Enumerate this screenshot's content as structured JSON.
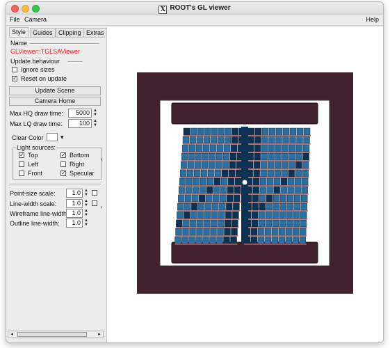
{
  "window": {
    "title": "ROOT's GL viewer",
    "title_icon": "X"
  },
  "menubar": {
    "file": "File",
    "camera": "Camera",
    "help": "Help"
  },
  "tabs": [
    "Style",
    "Guides",
    "Clipping",
    "Extras"
  ],
  "style_tab": {
    "name_label": "Name",
    "name_value": "GLViewer::TGLSAViewer",
    "update_behaviour": "Update behaviour",
    "ignore_sizes": {
      "label": "Ignore sizes",
      "checked": false
    },
    "reset_on_update": {
      "label": "Reset on update",
      "checked": true
    },
    "update_scene_button": "Update Scene",
    "camera_home_button": "Camera Home",
    "max_hq_label": "Max HQ draw time:",
    "max_hq_value": "5000",
    "max_lq_label": "Max LQ draw time:",
    "max_lq_value": "100",
    "clear_color_label": "Clear Color",
    "clear_color_arrow": "▾",
    "light_sources": {
      "title": "Light sources:",
      "top": {
        "label": "Top",
        "checked": true
      },
      "bottom": {
        "label": "Bottom",
        "checked": true
      },
      "left": {
        "label": "Left",
        "checked": false
      },
      "right": {
        "label": "Right",
        "checked": false
      },
      "front": {
        "label": "Front",
        "checked": false
      },
      "specular": {
        "label": "Specular",
        "checked": true
      }
    },
    "point_size_label": "Point-size scale:",
    "point_size_value": "1.0",
    "line_width_label": "Line-width scale:",
    "line_width_value": "1.0",
    "wireframe_label": "Wireframe line-width:",
    "wireframe_value": "1.0",
    "outline_label": "Outline line-width:",
    "outline_value": "1.0"
  },
  "check_glyph": "✓",
  "scroll": {
    "left_arrow": "◂",
    "right_arrow": "▸"
  },
  "side_arrow": "›",
  "spin": {
    "up": "▲",
    "down": "▼"
  },
  "colors": {
    "scene_background": "#42212f",
    "inner_frame": "#ffffff",
    "plate": "#42212f",
    "module_blue": "#2a6f9e",
    "module_dark": "#0e3352",
    "stripe": "#b06a6e",
    "name_text": "#e8222b"
  }
}
